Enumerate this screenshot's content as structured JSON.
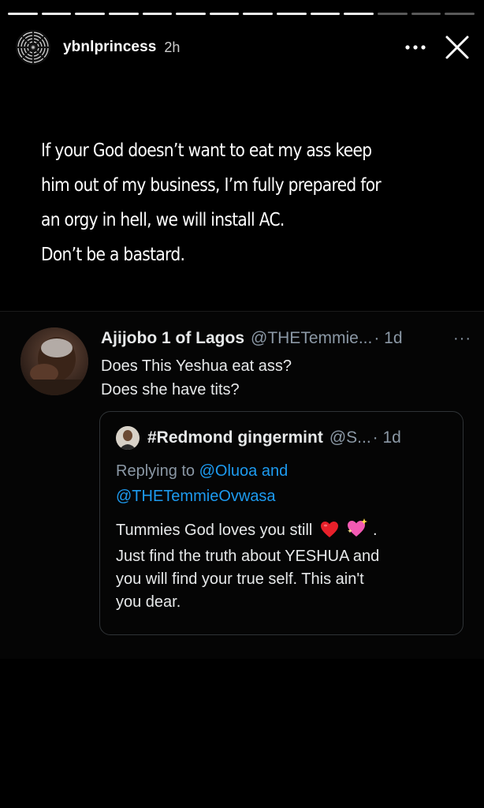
{
  "story": {
    "progress_segments": 14,
    "completed_segments": 11,
    "username": "ybnlprincess",
    "time": "2h"
  },
  "caption": {
    "lines": [
      "If your God doesn’t want to eat my ass keep",
      "him out of my business, I’m fully prepared for",
      "an orgy in hell, we will install AC.",
      "Don’t be a bastard."
    ]
  },
  "tweet": {
    "name": "Ajijobo 1 of Lagos",
    "handle": "@THETemmie...",
    "age": "· 1d",
    "more": "···",
    "lines": [
      "Does This Yeshua eat ass?",
      "Does she have tits?"
    ],
    "quote": {
      "name": "#Redmond gingermint",
      "handle": "@S...",
      "age": "· 1d",
      "replying_prefix": "Replying to",
      "mention_1": "@Oluoa",
      "connector": "and",
      "mention_2": "@THETemmieOvwasa",
      "line_1": "Tummies God loves you still",
      "line_1_end": ".",
      "lines": [
        "Just find the truth about YESHUA and",
        "you will find your true self. This ain't",
        "you dear."
      ],
      "emojis": [
        "red-heart-icon",
        "sparkling-heart-icon"
      ]
    }
  },
  "colors": {
    "background": "#000000",
    "link": "#1d9bf0",
    "muted": "#8b98a5",
    "text": "#e7e9ea",
    "card_border": "#2f3336"
  }
}
